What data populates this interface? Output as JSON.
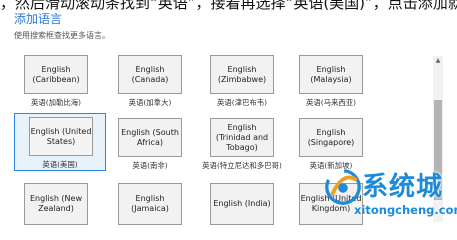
{
  "instruction_text": "，然后滑动滚动条找到“英语”，接着再选择“英语(美国)”，点击添加就行啦",
  "dialog": {
    "title": "添加语言",
    "hint": "使用搜索框查找更多语言。"
  },
  "languages": [
    {
      "label": "English (Caribbean)",
      "native": "英语(加勒比海)"
    },
    {
      "label": "English (Canada)",
      "native": "英语(加拿大)"
    },
    {
      "label": "English (Zimbabwe)",
      "native": "英语(津巴布韦)"
    },
    {
      "label": "English (Malaysia)",
      "native": "英语(马来西亚)"
    },
    {
      "label": "English (United States)",
      "native": "英语(美国)",
      "selected": true
    },
    {
      "label": "English (South Africa)",
      "native": "英语(南非)"
    },
    {
      "label": "English (Trinidad and Tobago)",
      "native": "英语(特立尼达和多巴哥)"
    },
    {
      "label": "English (Singapore)",
      "native": "英语(新加坡)"
    },
    {
      "label": "English (New Zealand)",
      "native": ""
    },
    {
      "label": "English (Jamaica)",
      "native": ""
    },
    {
      "label": "English (India)",
      "native": ""
    },
    {
      "label": "English (United Kingdom)",
      "native": ""
    }
  ],
  "watermark": {
    "name": "系统城",
    "url": "xitongcheng.com"
  },
  "colors": {
    "accent": "#2a7ad6",
    "selected_border": "#2f84e6",
    "selected_bg": "#e8f2fb",
    "watermark": "#1c8bd9"
  }
}
